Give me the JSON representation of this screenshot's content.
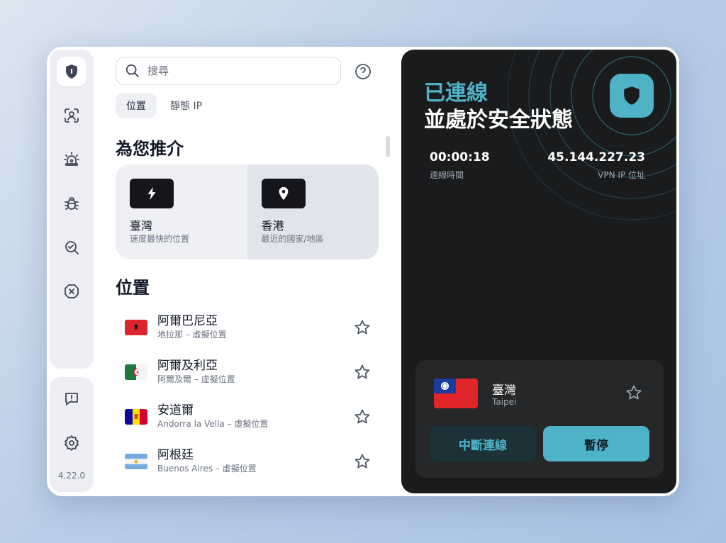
{
  "app": {
    "version": "4.22.0"
  },
  "sidebar": {
    "items": [
      {
        "icon": "shield-icon"
      },
      {
        "icon": "identity-scan-icon"
      },
      {
        "icon": "alarm-icon"
      },
      {
        "icon": "bug-icon"
      },
      {
        "icon": "search-magnify-icon"
      },
      {
        "icon": "block-icon"
      }
    ],
    "bottom": [
      {
        "icon": "feedback-icon"
      },
      {
        "icon": "gear-icon"
      }
    ]
  },
  "search": {
    "placeholder": "搜尋"
  },
  "tabs": [
    {
      "label": "位置",
      "active": true
    },
    {
      "label": "靜態 IP",
      "active": false
    }
  ],
  "recommended": {
    "title": "為您推介",
    "cards": [
      {
        "icon": "lightning-icon",
        "name": "臺灣",
        "sub": "速度最快的位置"
      },
      {
        "icon": "location-pin-icon",
        "name": "香港",
        "sub": "最近的國家/地區"
      }
    ]
  },
  "locations": {
    "title": "位置",
    "items": [
      {
        "name": "阿爾巴尼亞",
        "sub": "地拉那 – 虛擬位置",
        "flag": "albania"
      },
      {
        "name": "阿爾及利亞",
        "sub": "阿爾及爾 – 虛擬位置",
        "flag": "algeria"
      },
      {
        "name": "安道爾",
        "sub": "Andorra la Vella – 虛擬位置",
        "flag": "andorra"
      },
      {
        "name": "阿根廷",
        "sub": "Buenos Aires – 虛擬位置",
        "flag": "argentina"
      }
    ]
  },
  "status": {
    "line1": "已連線",
    "line2": "並處於安全狀態",
    "duration_value": "00:00:18",
    "duration_label": "連線時間",
    "ip_value": "45.144.227.23",
    "ip_label": "VPN IP 位址"
  },
  "connection": {
    "name": "臺灣",
    "sub": "Taipei",
    "disconnect_label": "中斷連線",
    "pause_label": "暫停"
  },
  "colors": {
    "accent": "#4fb3c8",
    "dark_bg": "#1a1b1d"
  }
}
